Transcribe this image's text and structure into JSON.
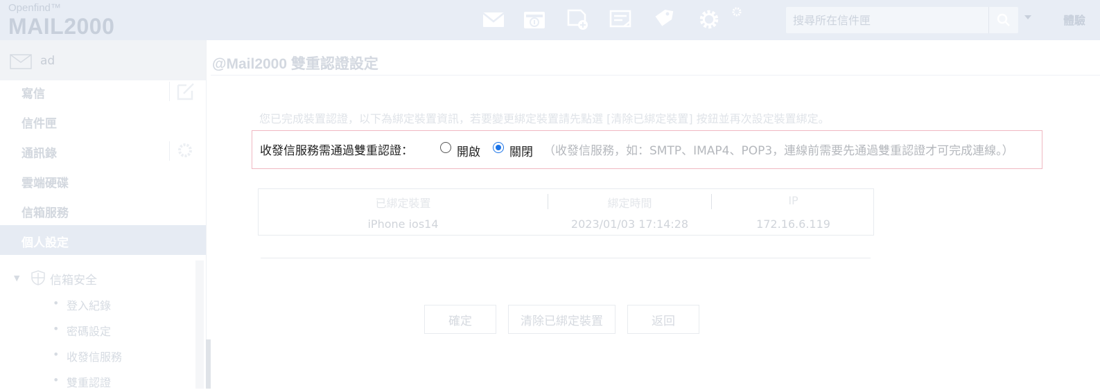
{
  "header": {
    "brand_small": "Openfind™",
    "brand_big": "MAIL2000",
    "search_placeholder": "搜尋所在信件匣",
    "lang_label": "體驗",
    "colors": {
      "bar": "#e8edf5",
      "icon": "#ffffff"
    },
    "toolbar_icons": [
      "mail-icon",
      "inbox-icon",
      "new-document-icon",
      "note-icon",
      "tag-icon",
      "gear-icon",
      "small-gear-icon"
    ]
  },
  "sidebar": {
    "account_name": "ad",
    "items": [
      {
        "label": "寫信"
      },
      {
        "label": "信件匣"
      },
      {
        "label": "通訊錄"
      },
      {
        "label": "雲端硬碟"
      },
      {
        "label": "信箱服務"
      },
      {
        "label": "個人設定"
      }
    ],
    "section": "信箱安全",
    "subitems": [
      "登入紀錄",
      "密碼設定",
      "收發信服務",
      "雙重認證"
    ]
  },
  "main": {
    "title": "@Mail2000 雙重認證設定",
    "notice": "您已完成裝置認證，以下為綁定裝置資訊，若要變更綁定裝置請先點選 [清除已綁定裝置] 按鈕並再次設定裝置綁定。",
    "auth": {
      "label": "收發信服務需通過雙重認證：",
      "option_on": "開啟",
      "option_off": "關閉",
      "selected": "關閉",
      "note": "（收發信服務，如：SMTP、IMAP4、POP3，連線前需要先通過雙重認證才可完成連線。）"
    },
    "table": {
      "headers": [
        "已綁定裝置",
        "綁定時間",
        "IP"
      ],
      "rows": [
        [
          "iPhone ios14",
          "2023/01/03 17:14:28",
          "172.16.6.119"
        ]
      ]
    },
    "buttons": {
      "confirm": "確定",
      "clear": "清除已綁定裝置",
      "back": "返回"
    }
  }
}
